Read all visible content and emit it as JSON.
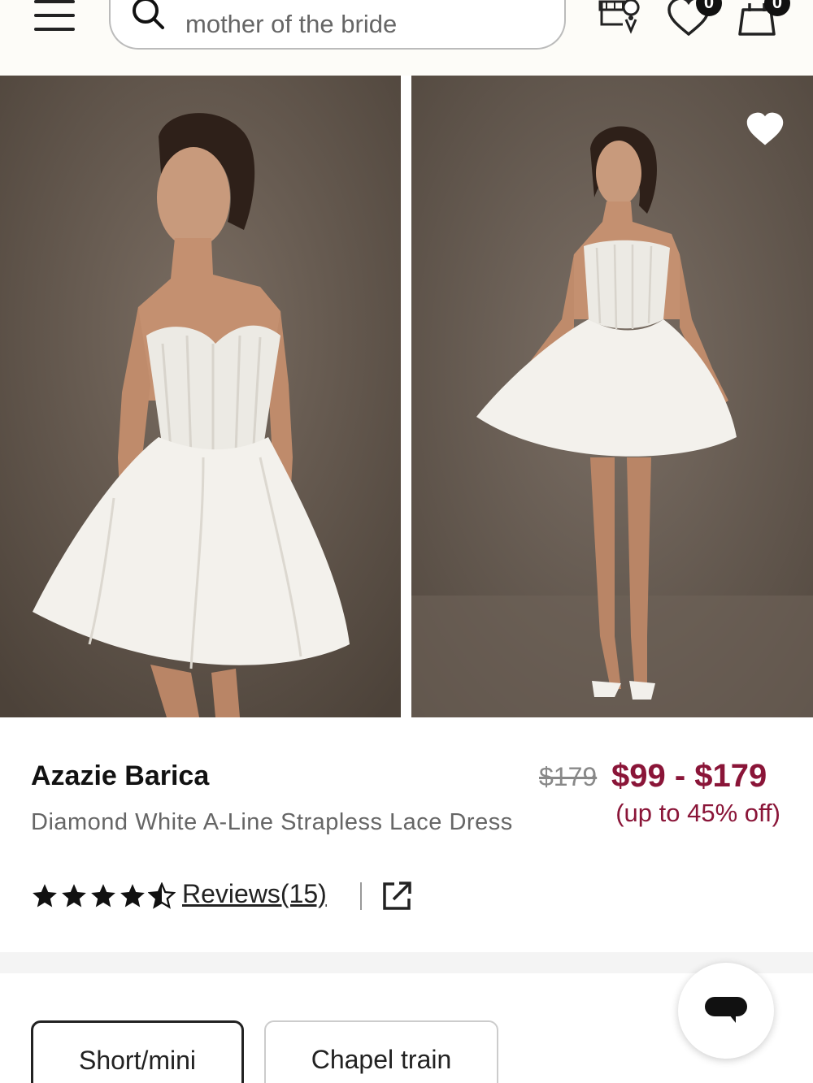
{
  "header": {
    "menu_icon": "hamburger-menu-icon",
    "search": {
      "value": "mother of the bride",
      "icon": "search-icon"
    },
    "store_icon": "store-locator-icon",
    "wishlist": {
      "icon": "heart-icon",
      "count": "0"
    },
    "cart": {
      "icon": "shopping-bag-icon",
      "count": "0"
    }
  },
  "gallery": {
    "images": [
      {
        "alt": "photo-front"
      },
      {
        "alt": "photo-full"
      }
    ],
    "favorite_icon": "heart-filled-icon"
  },
  "product": {
    "brand": "Azazie Barica",
    "name": "Diamond White A-Line Strapless Lace Dress",
    "rating": 4.5,
    "reviews_label": "Reviews(15)",
    "share_icon": "external-link-icon",
    "original_price": "$179",
    "price_range": "$99 - $179",
    "discount": "(up to 45% off)"
  },
  "options": {
    "chips": [
      {
        "label": "Short/mini",
        "selected": true
      },
      {
        "label": "Chapel train",
        "selected": false
      }
    ]
  },
  "chat": {
    "icon": "chat-bubble-icon"
  },
  "colors": {
    "accent": "#8a1538",
    "dress": "#f3f1ec",
    "backdrop": "#5e5248"
  }
}
